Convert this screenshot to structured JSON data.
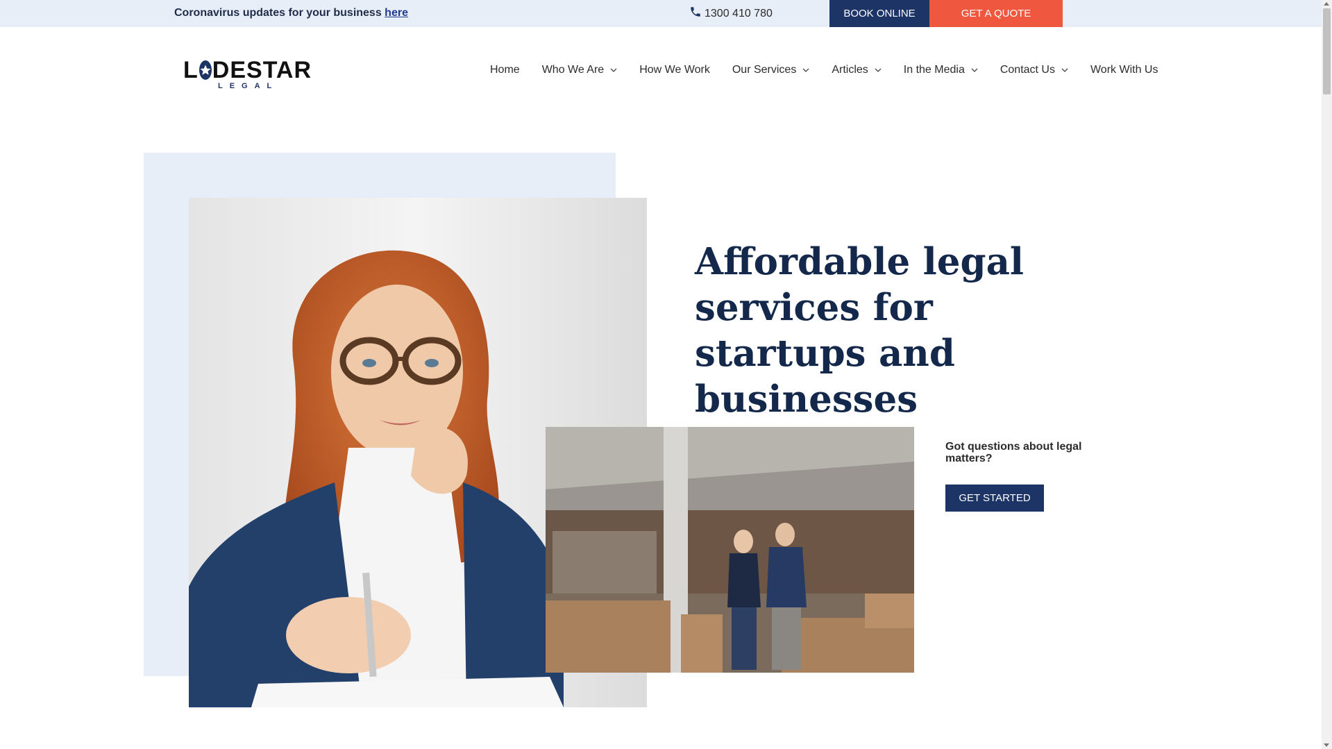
{
  "topbar": {
    "covid_text": "Coronavirus updates for your business ",
    "covid_link": "here",
    "phone": "1300 410 780",
    "book_online": "BOOK ONLINE",
    "get_quote": "GET A QUOTE"
  },
  "logo": {
    "main_left": "L",
    "main_right": "DESTAR",
    "sub": "LEGAL"
  },
  "nav": {
    "items": [
      {
        "label": "Home",
        "dropdown": false
      },
      {
        "label": "Who We Are",
        "dropdown": true
      },
      {
        "label": "How We Work",
        "dropdown": false
      },
      {
        "label": "Our Services",
        "dropdown": true
      },
      {
        "label": "Articles",
        "dropdown": true
      },
      {
        "label": "In the Media",
        "dropdown": true
      },
      {
        "label": "Contact Us",
        "dropdown": true
      },
      {
        "label": "Work With Us",
        "dropdown": false
      }
    ]
  },
  "hero": {
    "title": "Affordable legal services for startups and businesses",
    "questions": "Got questions about legal matters?",
    "cta": "GET STARTED"
  },
  "colors": {
    "navy": "#1d3466",
    "coral": "#f0573f",
    "light_blue": "#e8eef8",
    "heading": "#13284a"
  },
  "icons": {
    "phone": "phone-icon",
    "logo_star": "star-icon",
    "dropdown": "chevron-down-icon"
  }
}
